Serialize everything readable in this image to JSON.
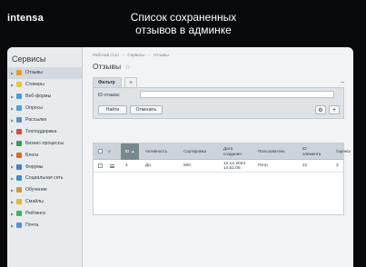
{
  "brand": {
    "logo": "intensa",
    "headline": "Список сохраненных отзывов в админке"
  },
  "sidebar": {
    "title": "Сервисы",
    "items": [
      {
        "label": "Отзывы",
        "icon": "reviews-icon",
        "color": "#e3a02a",
        "active": true
      },
      {
        "label": "Стикеры",
        "icon": "sticker-icon",
        "color": "#e8c53a"
      },
      {
        "label": "Веб-формы",
        "icon": "webform-icon",
        "color": "#4b9bd8"
      },
      {
        "label": "Опросы",
        "icon": "poll-icon",
        "color": "#4fa3d8"
      },
      {
        "label": "Рассылки",
        "icon": "mail-icon",
        "color": "#5e8fc8"
      },
      {
        "label": "Техподдержка",
        "icon": "support-icon",
        "color": "#d84b3a"
      },
      {
        "label": "Бизнес-процессы",
        "icon": "process-icon",
        "color": "#3a9c5c"
      },
      {
        "label": "Блоги",
        "icon": "blog-icon",
        "color": "#d86a2a"
      },
      {
        "label": "Форумы",
        "icon": "forum-icon",
        "color": "#4b7fc8"
      },
      {
        "label": "Социальная сеть",
        "icon": "social-icon",
        "color": "#3a8fc8"
      },
      {
        "label": "Обучение",
        "icon": "learning-icon",
        "color": "#c89a3a"
      },
      {
        "label": "Смайлы",
        "icon": "smile-icon",
        "color": "#e8b82a"
      },
      {
        "label": "Рейтинги",
        "icon": "rating-icon",
        "color": "#3ab85c"
      },
      {
        "label": "Почта",
        "icon": "mail-box-icon",
        "color": "#5a8fd8"
      }
    ]
  },
  "main": {
    "breadcrumbs": [
      "Рабочий стол",
      "›",
      "Сервисы",
      "›",
      "Отзывы"
    ],
    "title": "Отзывы",
    "filter": {
      "tab_label": "Фильтр",
      "add_tab": "+",
      "collapse": "–",
      "field_label": "ID отзыва:",
      "field_value": "",
      "find_label": "Найти",
      "cancel_label": "Отменить",
      "gear": "⚙",
      "plus": "+"
    },
    "table": {
      "headers": [
        "ID",
        "Активность",
        "Сортировка",
        "Дата создания",
        "Пользователь",
        "ID элемента",
        "Оценка"
      ],
      "rows": [
        {
          "id": "4",
          "active": "Да",
          "sort": "500",
          "date": "12.12.2023 14:51:05",
          "user": "Петр",
          "element_id": "21",
          "rating": "3"
        }
      ]
    }
  }
}
